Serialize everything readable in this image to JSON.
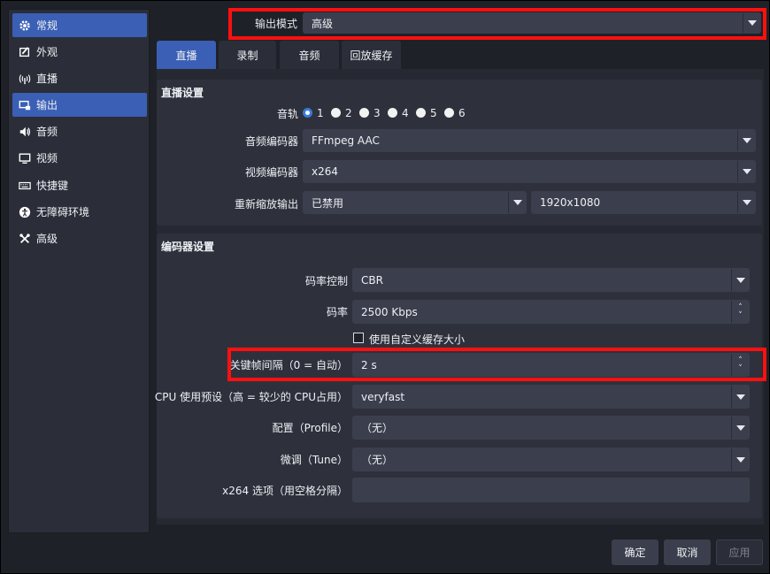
{
  "sidebar": {
    "items": [
      {
        "label": "常规",
        "icon": "gear-icon",
        "active": true
      },
      {
        "label": "外观",
        "icon": "appearance-icon",
        "active": false
      },
      {
        "label": "直播",
        "icon": "broadcast-icon",
        "active": false
      },
      {
        "label": "输出",
        "icon": "output-icon",
        "active": true
      },
      {
        "label": "音频",
        "icon": "speaker-icon",
        "active": false
      },
      {
        "label": "视频",
        "icon": "monitor-icon",
        "active": false
      },
      {
        "label": "快捷键",
        "icon": "keyboard-icon",
        "active": false
      },
      {
        "label": "无障碍环境",
        "icon": "accessibility-icon",
        "active": false
      },
      {
        "label": "高级",
        "icon": "tools-icon",
        "active": false
      }
    ]
  },
  "output_mode": {
    "label": "输出模式",
    "value": "高级"
  },
  "tabs": [
    {
      "label": "直播",
      "active": true
    },
    {
      "label": "录制",
      "active": false
    },
    {
      "label": "音频",
      "active": false
    },
    {
      "label": "回放缓存",
      "active": false
    }
  ],
  "stream_settings": {
    "title": "直播设置",
    "audio_track_label": "音轨",
    "tracks": [
      "1",
      "2",
      "3",
      "4",
      "5",
      "6"
    ],
    "selected_track": "1",
    "audio_encoder_label": "音频编码器",
    "audio_encoder": "FFmpeg AAC",
    "video_encoder_label": "视频编码器",
    "video_encoder": "x264",
    "rescale_label": "重新缩放输出",
    "rescale_value": "已禁用",
    "rescale_resolution": "1920x1080"
  },
  "encoder_settings": {
    "title": "编码器设置",
    "rate_control_label": "码率控制",
    "rate_control": "CBR",
    "bitrate_label": "码率",
    "bitrate": "2500 Kbps",
    "custom_buffer_label": "使用自定义缓存大小",
    "keyframe_label": "关键帧间隔（0 = 自动）",
    "keyframe": "2 s",
    "cpu_preset_label": "CPU 使用预设（高 = 较少的 CPU占用）",
    "cpu_preset": "veryfast",
    "profile_label": "配置（Profile）",
    "profile": "（无）",
    "tune_label": "微调（Tune）",
    "tune": "（无）",
    "x264_options_label": "x264 选项（用空格分隔）",
    "x264_options": ""
  },
  "buttons": {
    "ok": "确定",
    "cancel": "取消",
    "apply": "应用"
  },
  "colors": {
    "accent": "#3a5fb5",
    "highlight": "#ff1010"
  }
}
